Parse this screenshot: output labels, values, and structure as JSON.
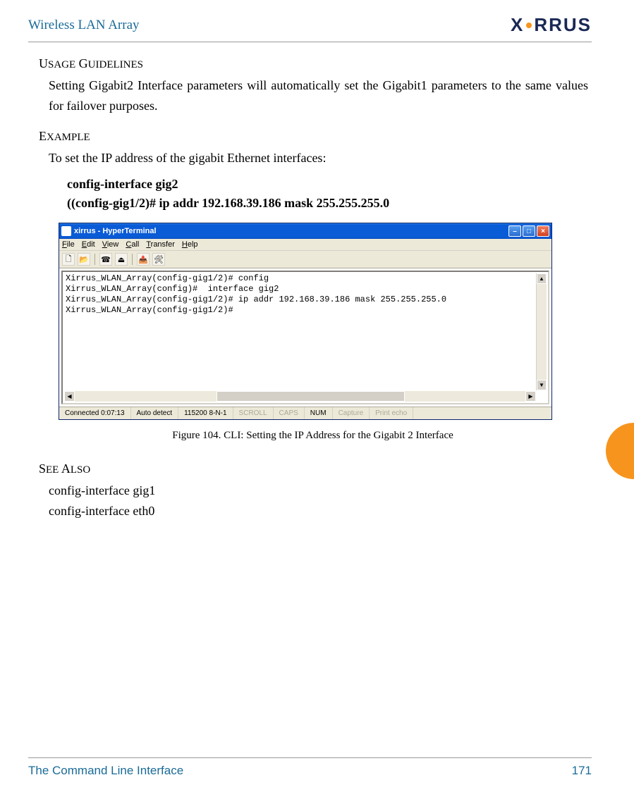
{
  "header": {
    "title": "Wireless LAN Array",
    "logo": "XIRRUS"
  },
  "sections": {
    "usage_guidelines": {
      "heading": "Usage Guidelines",
      "text": "Setting Gigabit2 Interface parameters will automatically set the Gigabit1 parameters to the same values for failover purposes."
    },
    "example": {
      "heading": "Example",
      "intro": "To set the IP address of the gigabit Ethernet interfaces:",
      "cmd1": "config-interface gig2",
      "cmd2": "((config-gig1/2)# ip addr 192.168.39.186 mask 255.255.255.0"
    },
    "see_also": {
      "heading": "See Also",
      "items": [
        "config-interface gig1",
        "config-interface eth0"
      ]
    }
  },
  "terminal": {
    "title": "xirrus - HyperTerminal",
    "menus": [
      "File",
      "Edit",
      "View",
      "Call",
      "Transfer",
      "Help"
    ],
    "lines": [
      "Xirrus_WLAN_Array(config-gig1/2)# config",
      "Xirrus_WLAN_Array(config)#  interface gig2",
      "Xirrus_WLAN_Array(config-gig1/2)# ip addr 192.168.39.186 mask 255.255.255.0",
      "Xirrus_WLAN_Array(config-gig1/2)#"
    ],
    "status": {
      "connected": "Connected 0:07:13",
      "detect": "Auto detect",
      "baud": "115200 8-N-1",
      "scroll": "SCROLL",
      "caps": "CAPS",
      "num": "NUM",
      "capture": "Capture",
      "echo": "Print echo"
    }
  },
  "figure_caption": "Figure 104. CLI: Setting the IP Address for the Gigabit 2 Interface",
  "footer": {
    "left": "The Command Line Interface",
    "right": "171"
  }
}
